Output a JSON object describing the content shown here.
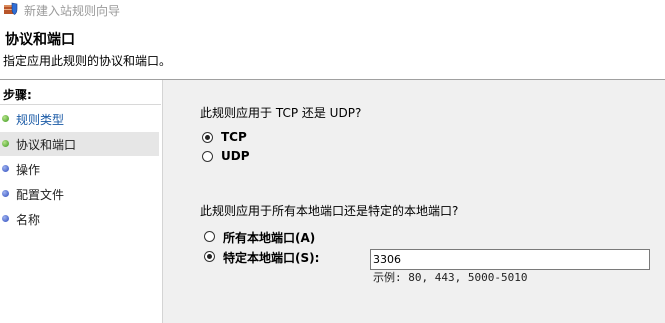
{
  "window": {
    "title": "新建入站规则向导",
    "icon": "firewall-shield-icon"
  },
  "header": {
    "title": "协议和端口",
    "subtitle": "指定应用此规则的协议和端口。"
  },
  "steps": {
    "heading": "步骤:",
    "items": [
      {
        "label": "规则类型",
        "status": "done",
        "link": true
      },
      {
        "label": "协议和端口",
        "status": "done",
        "link": false,
        "current": true
      },
      {
        "label": "操作",
        "status": "todo",
        "link": false
      },
      {
        "label": "配置文件",
        "status": "todo",
        "link": false
      },
      {
        "label": "名称",
        "status": "todo",
        "link": false
      }
    ]
  },
  "protocol": {
    "question": "此规则应用于 TCP 还是 UDP?",
    "options": [
      {
        "label": "TCP",
        "selected": true
      },
      {
        "label": "UDP",
        "selected": false
      }
    ]
  },
  "ports": {
    "question": "此规则应用于所有本地端口还是特定的本地端口?",
    "options": [
      {
        "label": "所有本地端口(A)",
        "selected": false
      },
      {
        "label": "特定本地端口(S):",
        "selected": true
      }
    ],
    "input_value": "3306",
    "example": "示例: 80, 443, 5000-5010"
  },
  "colors": {
    "done_dot": "#3c9a1e",
    "todo_dot": "#2d4bbd",
    "link_text": "#1a5aa6",
    "content_bg": "#f0f0f0"
  }
}
